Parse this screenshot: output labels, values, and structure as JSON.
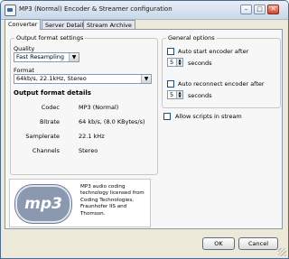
{
  "window": {
    "title": "MP3 (Normal) Encoder & Streamer configuration",
    "minimize_glyph": "–",
    "maximize_glyph": "□",
    "close_glyph": "✕"
  },
  "tabs": [
    {
      "label": "Converter",
      "active": true
    },
    {
      "label": "Server Details",
      "active": false
    },
    {
      "label": "Stream Archive",
      "active": false
    }
  ],
  "output_format": {
    "group_title": "Output format settings",
    "quality_label": "Quality",
    "quality_value": "Fast Resampling",
    "format_label": "Format",
    "format_value": "64kb/s, 22.1kHz, Stereo",
    "details_title": "Output format details",
    "details": [
      {
        "key": "Codec",
        "value": "MP3 (Normal)"
      },
      {
        "key": "Bitrate",
        "value": "64 kb/s, (8.0 KBytes/s)"
      },
      {
        "key": "Samplerate",
        "value": "22.1 kHz"
      },
      {
        "key": "Channels",
        "value": "Stereo"
      }
    ]
  },
  "logo": {
    "text": "mp3",
    "description": "MP3 audio coding technology licensed from Coding Technologies, Fraunhofer IIS and Thomson."
  },
  "general_options": {
    "group_title": "General options",
    "auto_start_label": "Auto start encoder after",
    "auto_start_value": "5",
    "auto_start_unit": "seconds",
    "auto_reconnect_label": "Auto reconnect encoder after",
    "auto_reconnect_value": "5",
    "auto_reconnect_unit": "seconds",
    "allow_scripts_label": "Allow scripts in stream"
  },
  "buttons": {
    "ok": "OK",
    "cancel": "Cancel"
  },
  "icons": {
    "dropdown": "▼",
    "spin_up": "▲",
    "spin_down": "▼"
  }
}
